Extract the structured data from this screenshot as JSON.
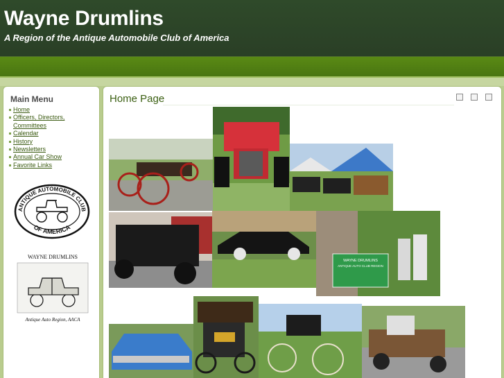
{
  "header": {
    "title": "Wayne Drumlins",
    "subtitle": "A Region of the Antique Automobile Club of America"
  },
  "sidebar": {
    "title": "Main Menu",
    "items": [
      {
        "label": "Home"
      },
      {
        "label": "Officers, Directors, Committees"
      },
      {
        "label": "Calendar"
      },
      {
        "label": "History"
      },
      {
        "label": "Newsletters"
      },
      {
        "label": "Annual Car Show"
      },
      {
        "label": "Favorite Links"
      }
    ],
    "logo1": {
      "top": "ANTIQUE AUTOMOBILE CLUB",
      "bottom": "OF AMERICA"
    },
    "logo2": {
      "top": "WAYNE DRUMLINS",
      "bottom": "Antique Auto Region, AACA"
    }
  },
  "main": {
    "title": "Home Page",
    "tools": [
      "pdf-icon",
      "print-icon",
      "email-icon"
    ],
    "banner": {
      "line1": "WAYNE DRUMLINS",
      "line2": "ANTIQUE AUTO CLUB REGION"
    }
  },
  "colors": {
    "header": "#2f4a2a",
    "nav": "#497512",
    "accent": "#3b5f12",
    "background": "#b9cc8e"
  }
}
